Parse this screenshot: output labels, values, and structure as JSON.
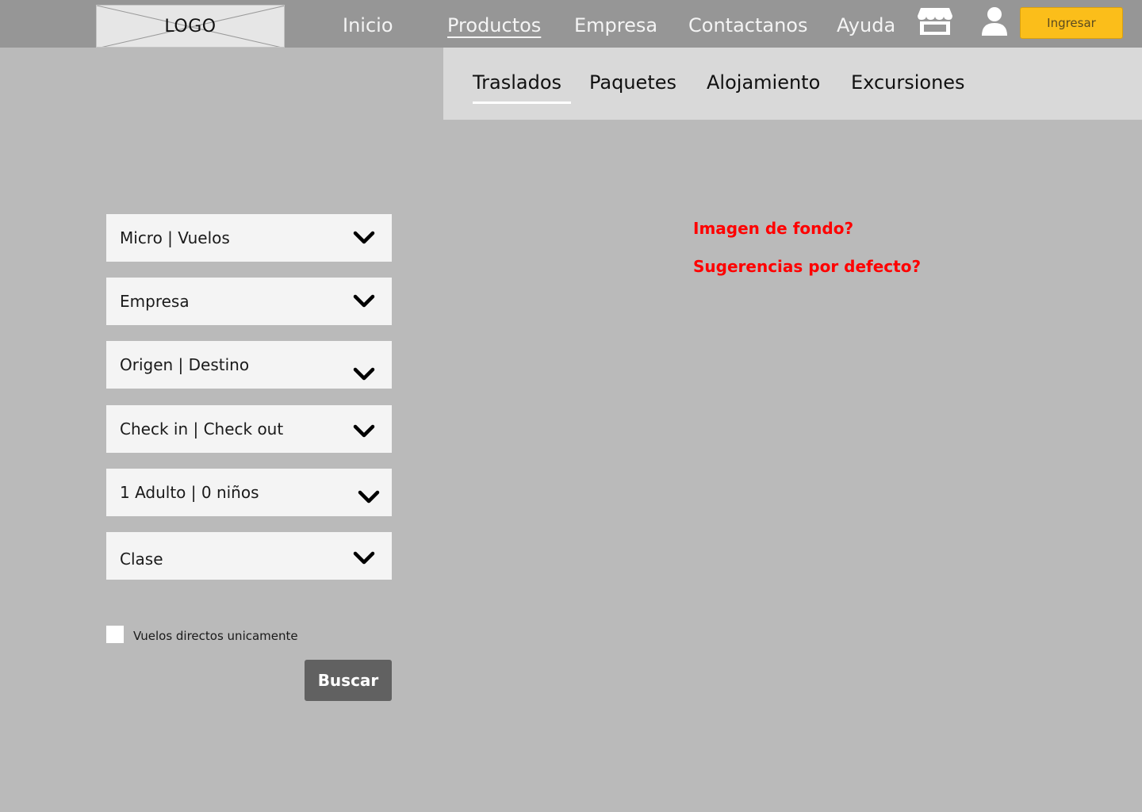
{
  "header": {
    "logo_text": "LOGO",
    "nav": [
      {
        "label": "Inicio"
      },
      {
        "label": "Productos",
        "active": true
      },
      {
        "label": "Empresa"
      },
      {
        "label": "Contactanos"
      },
      {
        "label": "Ayuda"
      }
    ],
    "icons": [
      "store-icon",
      "user-icon"
    ],
    "login_button": "Ingresar"
  },
  "subnav": {
    "tabs": [
      {
        "label": "Traslados",
        "active": true
      },
      {
        "label": "Paquetes"
      },
      {
        "label": "Alojamiento"
      },
      {
        "label": "Excursiones"
      }
    ]
  },
  "form": {
    "fields": [
      {
        "label": "Micro | Vuelos"
      },
      {
        "label": "Empresa"
      },
      {
        "label": "Origen | Destino"
      },
      {
        "label": "Check in | Check out"
      },
      {
        "label": "1 Adulto | 0 niños"
      },
      {
        "label": "Clase"
      }
    ],
    "direct_flights_label": "Vuelos directos unicamente",
    "direct_flights_checked": false,
    "search_button": "Buscar"
  },
  "notes": {
    "background_question": "Imagen de fondo?",
    "suggestions_question": "Sugerencias por defecto?"
  },
  "colors": {
    "topbar": "#969696",
    "page_background": "#bababa",
    "subnav_background": "#d9d9d9",
    "field_background": "#f4f4f4",
    "login_accent": "#fbbe1a",
    "search_button": "#616161",
    "note_text": "#ff0000"
  }
}
